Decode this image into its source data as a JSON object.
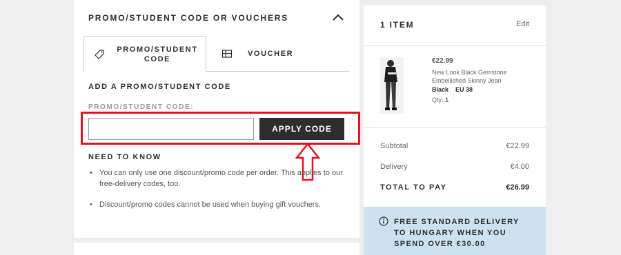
{
  "promo_section": {
    "header": "PROMO/STUDENT CODE OR VOUCHERS",
    "tabs": [
      {
        "label": "PROMO/STUDENT CODE",
        "icon": "tag-icon",
        "active": true
      },
      {
        "label": "VOUCHER",
        "icon": "voucher-icon",
        "active": false
      }
    ],
    "subhead": "ADD A PROMO/STUDENT CODE",
    "field_label": "PROMO/STUDENT CODE:",
    "field_value": "",
    "apply_button": "APPLY CODE",
    "need_to_know": "NEED TO KNOW",
    "bullets": [
      "You can only use one discount/promo code per order. This applies to our free-delivery codes, too.",
      "Discount/promo codes cannot be used when buying gift vouchers."
    ]
  },
  "bag": {
    "item_count": "1 ITEM",
    "edit": "Edit",
    "product": {
      "price": "€22.99",
      "name": "New Look Black Gemstone Embellished Skinny Jean",
      "colour": "Black",
      "size": "EU 38",
      "qty_label": "Qty:",
      "qty": "1"
    },
    "summary": {
      "subtotal_label": "Subtotal",
      "subtotal": "€22.99",
      "delivery_label": "Delivery",
      "delivery": "€4.00",
      "total_label": "TOTAL TO PAY",
      "total": "€26.99"
    },
    "banner": "FREE STANDARD DELIVERY TO HUNGARY WHEN YOU SPEND OVER €30.00"
  },
  "colors": {
    "highlight": "#e0141e",
    "button": "#2d2d2d",
    "banner_bg": "#cde2f1"
  }
}
